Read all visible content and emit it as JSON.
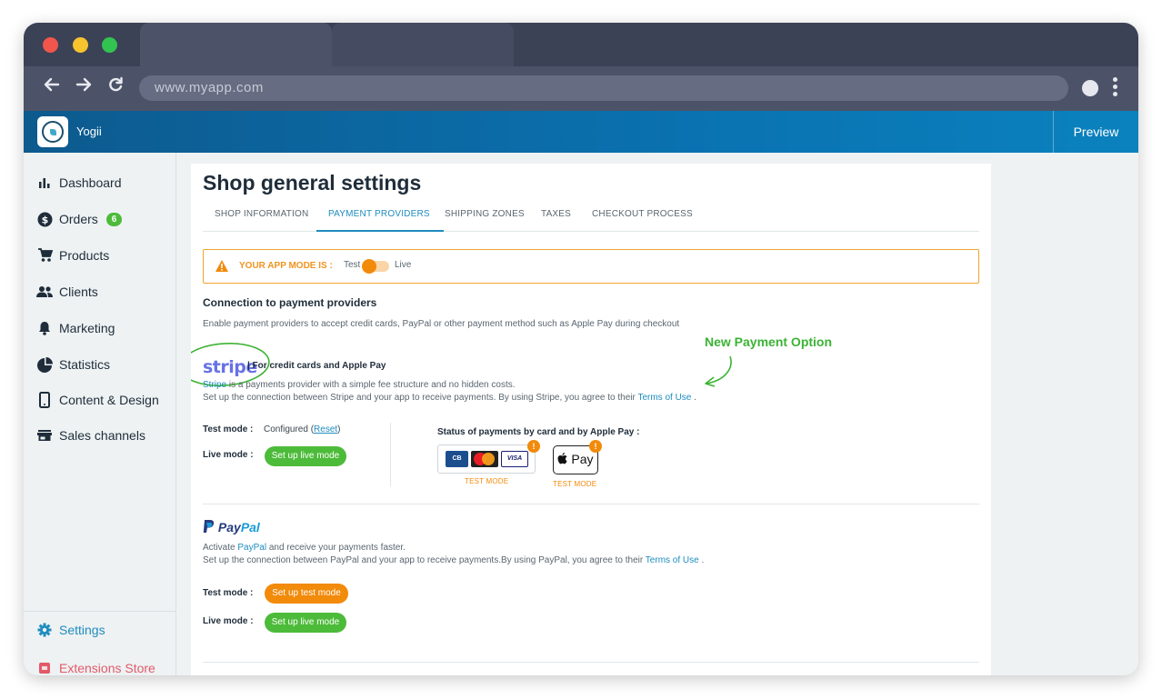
{
  "browser": {
    "url": "www.myapp.com"
  },
  "app": {
    "name": "Yogii",
    "preview_label": "Preview"
  },
  "sidebar": {
    "items": [
      {
        "label": "Dashboard",
        "icon": "bar-chart-icon"
      },
      {
        "label": "Orders",
        "icon": "dollar-icon",
        "badge": "6"
      },
      {
        "label": "Products",
        "icon": "cart-icon"
      },
      {
        "label": "Clients",
        "icon": "people-icon"
      },
      {
        "label": "Marketing",
        "icon": "bell-icon"
      },
      {
        "label": "Statistics",
        "icon": "pie-chart-icon"
      },
      {
        "label": "Content & Design",
        "icon": "phone-icon"
      },
      {
        "label": "Sales channels",
        "icon": "store-icon"
      }
    ],
    "settings_label": "Settings",
    "extensions_label": "Extensions Store"
  },
  "page": {
    "title": "Shop general settings",
    "tabs": [
      {
        "label": "SHOP INFORMATION",
        "active": false
      },
      {
        "label": "PAYMENT PROVIDERS",
        "active": true
      },
      {
        "label": "SHIPPING ZONES",
        "active": false
      },
      {
        "label": "TAXES",
        "active": false
      },
      {
        "label": "CHECKOUT PROCESS",
        "active": false
      }
    ]
  },
  "app_mode": {
    "label": "YOUR APP MODE IS :",
    "test": "Test",
    "live": "Live"
  },
  "providers": {
    "title": "Connection to payment providers",
    "description": "Enable payment providers to accept credit cards, PayPal or other payment method such as Apple Pay during checkout"
  },
  "annotation": {
    "new_option": "New Payment Option"
  },
  "stripe": {
    "logo": "stripe",
    "tagline": "| For credit cards and Apple Pay",
    "line1_link": "Stripe",
    "line1_rest": " is a payments provider with a simple fee structure and no hidden costs.",
    "line2": "Set up the connection between Stripe and your app to receive payments. By using Stripe, you agree to their ",
    "terms": "Terms of Use",
    "line2_end": " .",
    "test_mode_label": "Test mode :",
    "test_mode_value": "Configured (",
    "reset_link": "Reset",
    "test_mode_close": ")",
    "live_mode_label": "Live mode :",
    "live_button": "Set up live mode",
    "status_title": "Status of payments by card and by Apple Pay :",
    "cards": {
      "cb": "CB",
      "mastercard": "MasterCard",
      "visa": "VISA"
    },
    "apple_pay": " Pay",
    "card_status": "TEST MODE",
    "apple_status": "TEST MODE"
  },
  "paypal": {
    "logo_a": "Pay",
    "logo_b": "Pal",
    "line1_pre": "Activate ",
    "line1_link": "PayPal",
    "line1_rest": " and receive your payments faster.",
    "line2": "Set up the connection between PayPal and your app to receive payments.By using PayPal, you agree to their ",
    "terms": "Terms of Use",
    "line2_end": " .",
    "test_mode_label": "Test mode :",
    "test_button": "Set up test mode",
    "live_mode_label": "Live mode :",
    "live_button": "Set up live mode"
  },
  "colors": {
    "accent": "#1e8cbf",
    "green": "#4dbb3a",
    "orange": "#f28a0a",
    "annotation_green": "#3cb334"
  }
}
